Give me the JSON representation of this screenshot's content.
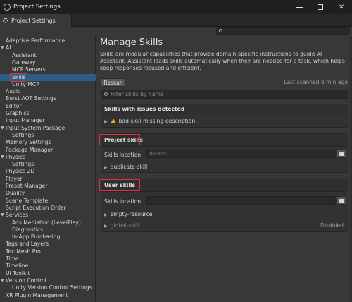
{
  "window": {
    "title": "Project Settings",
    "icon": "unity-logo-icon"
  },
  "tab": {
    "label": "Project Settings",
    "icon": "gear-icon",
    "menu_icon": "kebab-menu-icon"
  },
  "search": {
    "placeholder": ""
  },
  "sidebar": {
    "items": [
      {
        "label": "Adaptive Performance",
        "indent": 0
      },
      {
        "label": "AI",
        "indent": 0,
        "expanded": true
      },
      {
        "label": "Assistant",
        "indent": 1
      },
      {
        "label": "Gateway",
        "indent": 1
      },
      {
        "label": "MCP Servers",
        "indent": 1
      },
      {
        "label": "Skills",
        "indent": 1,
        "selected": true
      },
      {
        "label": "Unity MCP",
        "indent": 1
      },
      {
        "label": "Audio",
        "indent": 0
      },
      {
        "label": "Burst AOT Settings",
        "indent": 0
      },
      {
        "label": "Editor",
        "indent": 0
      },
      {
        "label": "Graphics",
        "indent": 0
      },
      {
        "label": "Input Manager",
        "indent": 0
      },
      {
        "label": "Input System Package",
        "indent": 0,
        "expanded": true
      },
      {
        "label": "Settings",
        "indent": 1
      },
      {
        "label": "Memory Settings",
        "indent": 0
      },
      {
        "label": "Package Manager",
        "indent": 0
      },
      {
        "label": "Physics",
        "indent": 0,
        "expanded": true
      },
      {
        "label": "Settings",
        "indent": 1
      },
      {
        "label": "Physics 2D",
        "indent": 0
      },
      {
        "label": "Player",
        "indent": 0
      },
      {
        "label": "Preset Manager",
        "indent": 0
      },
      {
        "label": "Quality",
        "indent": 0
      },
      {
        "label": "Scene Template",
        "indent": 0
      },
      {
        "label": "Script Execution Order",
        "indent": 0
      },
      {
        "label": "Services",
        "indent": 0,
        "expanded": true
      },
      {
        "label": "Ads Mediation (LevelPlay)",
        "indent": 1
      },
      {
        "label": "Diagnostics",
        "indent": 1
      },
      {
        "label": "In-App Purchasing",
        "indent": 1
      },
      {
        "label": "Tags and Layers",
        "indent": 0
      },
      {
        "label": "TextMesh Pro",
        "indent": 0
      },
      {
        "label": "Time",
        "indent": 0
      },
      {
        "label": "Timeline",
        "indent": 0
      },
      {
        "label": "UI Toolkit",
        "indent": 0
      },
      {
        "label": "Version Control",
        "indent": 0,
        "expanded": true
      },
      {
        "label": "Unity Version Control Settings",
        "indent": 1
      },
      {
        "label": "XR Plugin Management",
        "indent": 0
      }
    ]
  },
  "main": {
    "title": "Manage Skills",
    "description": "Skills are modular capabilities that provide domain-specific instructions to guide AI Assistant. Assistant loads skills automatically when they are needed for a task, which helps keep responses focused and efficient.",
    "rescan_label": "Rescan",
    "last_scanned": "Last scanned 8 min ago",
    "filter_placeholder": "Filter skills by name",
    "issues": {
      "header": "Skills with issues detected",
      "items": [
        {
          "label": "bad-skill-missing-description",
          "icon": "warning-icon"
        }
      ]
    },
    "project": {
      "header": "Project skills",
      "location_label": "Skills location",
      "location_value": "Assets",
      "items": [
        {
          "label": "duplicate-skill"
        }
      ]
    },
    "user": {
      "header": "User skills",
      "location_label": "Skills location",
      "location_value": "",
      "items": [
        {
          "label": "empty-resource",
          "status": ""
        },
        {
          "label": "global-skill",
          "status": "Disabled"
        }
      ]
    }
  },
  "colors": {
    "selection": "#2c5d87",
    "highlight_box": "#e0303a",
    "warning": "#f0b400"
  }
}
